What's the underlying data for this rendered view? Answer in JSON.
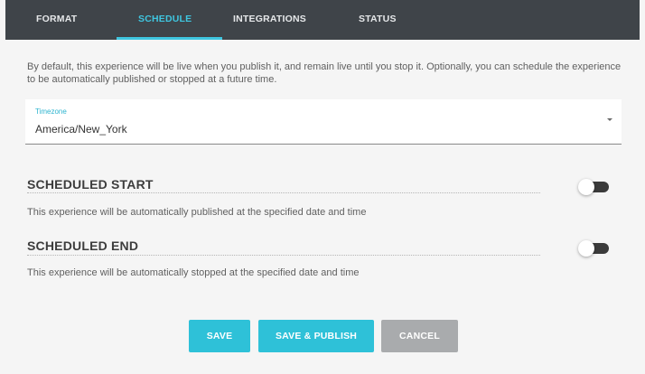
{
  "tabs": [
    {
      "label": "FORMAT"
    },
    {
      "label": "SCHEDULE"
    },
    {
      "label": "INTEGRATIONS"
    },
    {
      "label": "STATUS"
    }
  ],
  "active_tab": "SCHEDULE",
  "intro_text": "By default, this experience will be live when you publish it, and remain live until you stop it. Optionally, you can schedule the experience to be automatically published or stopped at a future time.",
  "timezone": {
    "label": "Timezone",
    "value": "America/New_York",
    "icon": "caret-down-icon"
  },
  "scheduled_start": {
    "title": "SCHEDULED START",
    "description": "This experience will be automatically published at the specified date and time",
    "enabled": false
  },
  "scheduled_end": {
    "title": "SCHEDULED END",
    "description": "This experience will be automatically stopped at the specified date and time",
    "enabled": false
  },
  "buttons": {
    "save": "SAVE",
    "save_publish": "SAVE & PUBLISH",
    "cancel": "CANCEL"
  },
  "colors": {
    "tabbar_bg": "#3f4449",
    "accent": "#3fc6e0",
    "button_primary": "#2ec1d8",
    "button_cancel": "#a9abad"
  }
}
